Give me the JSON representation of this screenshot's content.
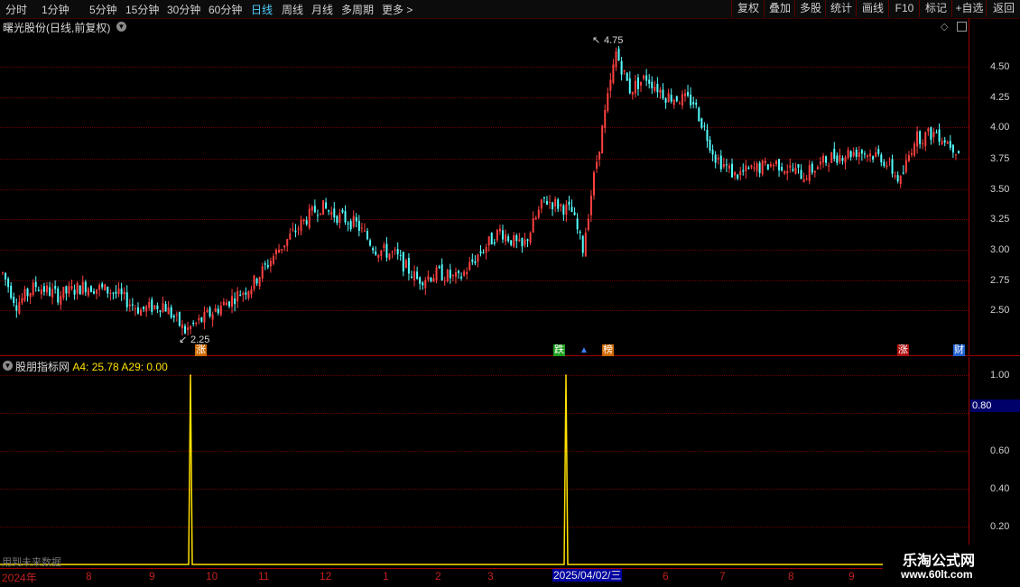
{
  "toolbar": {
    "period_tabs": [
      "分时",
      "1分钟",
      "5分钟",
      "15分钟",
      "30分钟",
      "60分钟",
      "日线",
      "周线",
      "月线",
      "多周期",
      "更多 >"
    ],
    "active_tab": "日线",
    "right_buttons": [
      "复权",
      "叠加",
      "多股",
      "统计",
      "画线",
      "F10",
      "标记",
      "+自选",
      "返回"
    ]
  },
  "main_chart": {
    "title": "曙光股份(日线,前复权)",
    "y_ticks": [
      "4.50",
      "4.25",
      "4.00",
      "3.75",
      "3.50",
      "3.25",
      "3.00",
      "2.75",
      "2.50"
    ],
    "high_label": "4.75",
    "low_label": "2.25",
    "markers": [
      {
        "text": "涨",
        "color": "#d06a00"
      },
      {
        "text": "跌",
        "color": "#20a020"
      },
      {
        "text": "榜",
        "color": "#d06a00"
      },
      {
        "text": "涨",
        "color": "#b01010"
      },
      {
        "text": "财",
        "color": "#2060d0"
      }
    ]
  },
  "indicator": {
    "name": "股朋指标网",
    "values_text": "A4: 25.78  A29: 0.00",
    "y_ticks": [
      "1.00",
      "0.60",
      "0.40",
      "0.20"
    ],
    "current_value": "0.80",
    "future_note": "用到未来数据"
  },
  "x_axis": {
    "labels": [
      "2024年",
      "8",
      "9",
      "10",
      "11",
      "12",
      "1",
      "2",
      "3",
      "6",
      "7",
      "8",
      "9"
    ],
    "cursor_date": "2025/04/02/三"
  },
  "watermark": {
    "line1": "乐淘公式网",
    "line2": "www.60lt.com"
  },
  "colors": {
    "up": "#ff4040",
    "down": "#54ffff",
    "signal": "#ffe000",
    "axis": "#a00000",
    "accent": "#4fd0ff"
  },
  "chart_data": {
    "type": "line",
    "title": "",
    "xlabel": "",
    "ylabel": "",
    "series": [
      {
        "name": "A4",
        "x": [
          "2024-09",
          "2025-04-02"
        ],
        "values": [
          1.0,
          1.0
        ]
      }
    ],
    "ylim": [
      0,
      1.05
    ],
    "price_range": [
      2.25,
      4.75
    ],
    "grid": true
  }
}
